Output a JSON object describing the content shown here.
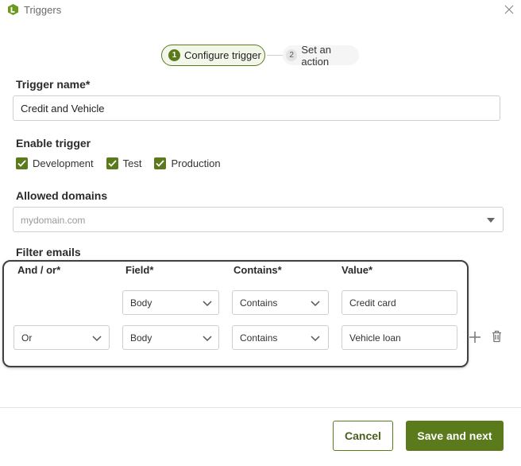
{
  "window": {
    "title": "Triggers"
  },
  "stepper": {
    "steps": [
      {
        "num": "1",
        "label": "Configure trigger"
      },
      {
        "num": "2",
        "label": "Set an action"
      }
    ]
  },
  "trigger_name": {
    "label": "Trigger name*",
    "value": "Credit and Vehicle"
  },
  "enable_trigger": {
    "label": "Enable trigger",
    "options": [
      {
        "label": "Development",
        "checked": true
      },
      {
        "label": "Test",
        "checked": true
      },
      {
        "label": "Production",
        "checked": true
      }
    ]
  },
  "allowed_domains": {
    "label": "Allowed domains",
    "placeholder": "mydomain.com"
  },
  "filter_emails": {
    "label": "Filter emails",
    "columns": [
      "And / or*",
      "Field*",
      "Contains*",
      "Value*"
    ],
    "rows": [
      {
        "andor": "",
        "field": "Body",
        "contains": "Contains",
        "value": "Credit card"
      },
      {
        "andor": "Or",
        "field": "Body",
        "contains": "Contains",
        "value": "Vehicle loan"
      }
    ]
  },
  "footer": {
    "cancel": "Cancel",
    "save": "Save and next"
  },
  "colors": {
    "accent": "#5a7a1c",
    "border": "#cfcfcf",
    "frame": "#404040"
  },
  "icons": [
    "app-logo-icon",
    "close-icon",
    "chevron-down-icon",
    "add-icon",
    "trash-icon",
    "checkmark-icon"
  ]
}
